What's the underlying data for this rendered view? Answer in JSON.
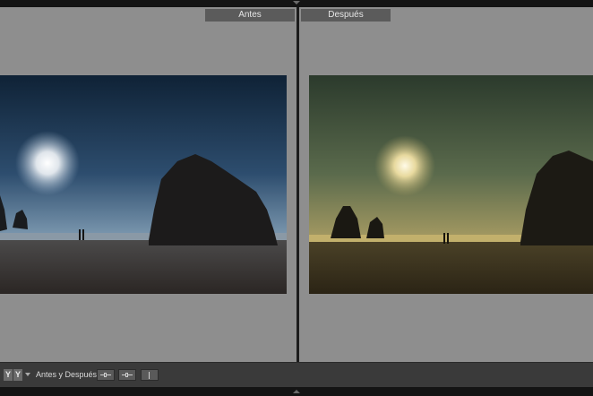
{
  "panes": {
    "before_label": "Antes",
    "after_label": "Después"
  },
  "toolbar": {
    "view_mode_left": "Y",
    "view_mode_right": "Y",
    "compare_label": "Antes y Después:"
  },
  "photos": {
    "before_alt": "",
    "after_alt": ""
  },
  "colors": {
    "workspace_background": "#8e8e8e",
    "toolbar_background": "#3a3a3a",
    "label_background": "#5b5b5b"
  },
  "icons": {
    "top_panel_toggle": "triangle-down-icon",
    "bottom_panel_toggle": "triangle-up-icon",
    "copy_before_to_after": "copy-left-to-right-icon",
    "copy_after_to_before": "copy-right-to-left-icon",
    "swap": "swap-icon"
  }
}
